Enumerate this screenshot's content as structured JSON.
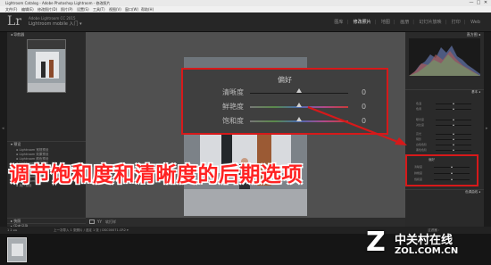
{
  "window": {
    "title": "Lightroom Catalog - Adobe Photoshop Lightroom - 修改照片",
    "controls": [
      "—",
      "□",
      "✕"
    ]
  },
  "menubar": [
    "文件(F)",
    "编辑(E)",
    "修改照片(D)",
    "照片(P)",
    "设置(S)",
    "工具(T)",
    "视图(V)",
    "窗口(W)",
    "帮助(H)"
  ],
  "identity": {
    "logo": "Lr",
    "catalog": "Adobe Lightroom CC 2015",
    "mobile": "Lightroom mobile 入门 ▾"
  },
  "modules": [
    {
      "label": "图库",
      "active": false
    },
    {
      "label": "修改照片",
      "active": true
    },
    {
      "label": "地图",
      "active": false
    },
    {
      "label": "画册",
      "active": false
    },
    {
      "label": "幻灯片放映",
      "active": false
    },
    {
      "label": "打印",
      "active": false
    },
    {
      "label": "Web",
      "active": false
    }
  ],
  "left_panel": {
    "navigator": "◂ 导航器",
    "presets_header": "▾ 预设",
    "presets": [
      "Lightroom 常规预设",
      "Lightroom 效果预设",
      "Lightroom 颜色预设",
      "Lightroom 黑白预设",
      "Lightroom 黑白滤镜",
      "Lightroom 黑白色调",
      "Lightroom 曲线预设",
      "Lightroom 视频预设",
      "用户预设"
    ],
    "snapshots": "▸ 快照",
    "history": "▸ 历史记录",
    "collections": "▸ 收藏夹",
    "copy_btn": "复制...",
    "paste_btn": "粘贴"
  },
  "preferences_box": {
    "title": "偏好",
    "sliders": [
      {
        "label": "清晰度",
        "value": "0",
        "position": 0.5
      },
      {
        "label": "鲜艳度",
        "value": "0",
        "position": 0.5
      },
      {
        "label": "饱和度",
        "value": "0",
        "position": 0.5
      }
    ]
  },
  "right_panel": {
    "histogram": "直方图 ◂",
    "tone_header": "基本 ◂",
    "rows": [
      "色温",
      "色调",
      "曝光度",
      "对比度",
      "高光",
      "阴影",
      "白色色阶",
      "黑色色阶"
    ],
    "pref_section": "偏好",
    "pref_rows": [
      "清晰度",
      "鲜艳度",
      "饱和度"
    ],
    "tone_curve": "色调曲线 ◂",
    "prev_btn": "上一张",
    "reset_btn": "复位"
  },
  "toolbar": {
    "soft_proof": "软打样"
  },
  "filmstrip_bar": {
    "nav": "1 2 ◂ ▸",
    "location": "上一次导入  1 张照片 / 选定 1 张 / DSC00071.CR2 ▾",
    "filter": "过滤器 :"
  },
  "annotation": {
    "caption": "调节饱和度和清晰度的后期选项",
    "caption_color": "#ff2222",
    "highlight_color": "#d6191a"
  },
  "watermark": {
    "logo": "Z",
    "name": "中关村在线",
    "domain": "ZOL.COM.CN"
  }
}
